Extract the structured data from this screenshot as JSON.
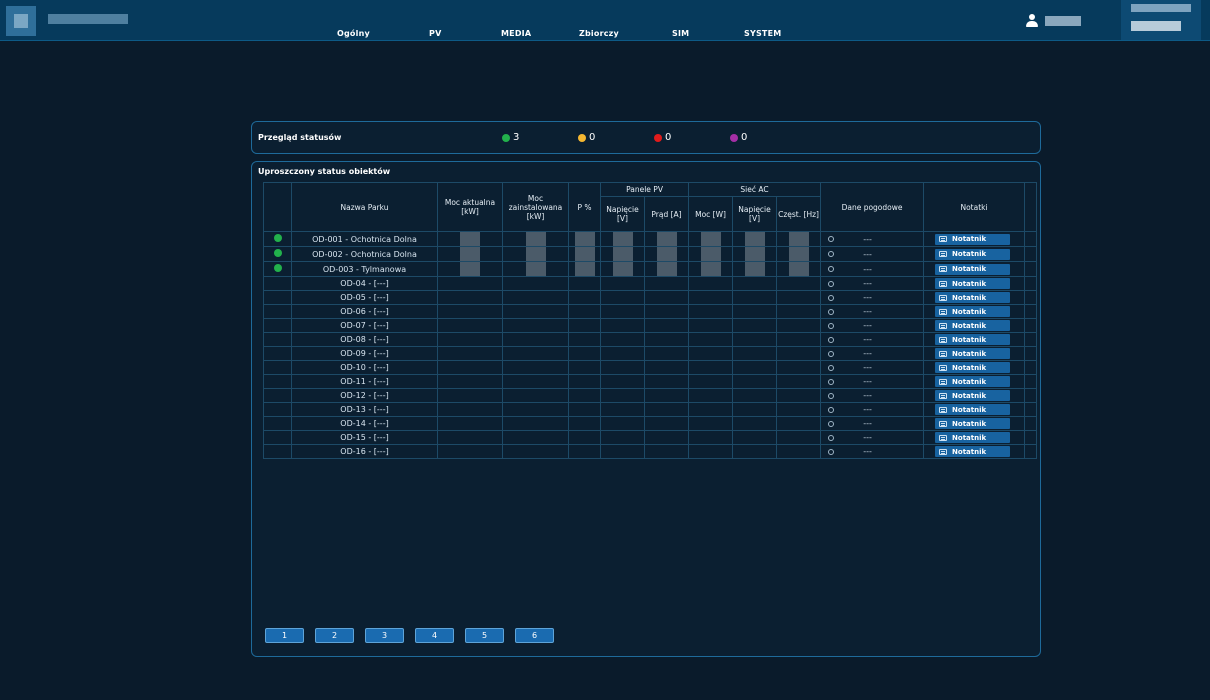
{
  "nav": {
    "items": [
      "Ogólny",
      "PV",
      "MEDIA",
      "Zbiorczy",
      "SIM",
      "SYSTEM"
    ]
  },
  "status_overview": {
    "title": "Przegląd statusów",
    "counts": [
      {
        "color": "#22b14c",
        "value": "3"
      },
      {
        "color": "#f5b731",
        "value": "0"
      },
      {
        "color": "#e01b1b",
        "value": "0"
      },
      {
        "color": "#a52fa6",
        "value": "0"
      }
    ]
  },
  "objects_table": {
    "title": "Uproszczony status obiektów",
    "headers": {
      "name": "Nazwa Parku",
      "current_power": "Moc aktualna [kW]",
      "installed_power": "Moc zainstalowana [kW]",
      "p_percent": "P %",
      "pv_group": "Panele PV",
      "pv_voltage": "Napięcie [V]",
      "pv_current": "Prąd [A]",
      "ac_group": "Sieć AC",
      "ac_power": "Moc [W]",
      "ac_voltage": "Napięcie [V]",
      "ac_freq": "Częst. [Hz]",
      "weather": "Dane pogodowe",
      "notes": "Notatki"
    },
    "weather_placeholder": "---",
    "note_button_label": "Notatnik",
    "rows": [
      {
        "name": "OD-001 - Ochotnica Dolna",
        "status": "green"
      },
      {
        "name": "OD-002 - Ochotnica Dolna",
        "status": "green"
      },
      {
        "name": "OD-003 - Tylmanowa",
        "status": "green"
      },
      {
        "name": "OD-04 - [---]",
        "status": ""
      },
      {
        "name": "OD-05 - [---]",
        "status": ""
      },
      {
        "name": "OD-06 - [---]",
        "status": ""
      },
      {
        "name": "OD-07 - [---]",
        "status": ""
      },
      {
        "name": "OD-08 - [---]",
        "status": ""
      },
      {
        "name": "OD-09 - [---]",
        "status": ""
      },
      {
        "name": "OD-10 - [---]",
        "status": ""
      },
      {
        "name": "OD-11 - [---]",
        "status": ""
      },
      {
        "name": "OD-12 - [---]",
        "status": ""
      },
      {
        "name": "OD-13 - [---]",
        "status": ""
      },
      {
        "name": "OD-14 - [---]",
        "status": ""
      },
      {
        "name": "OD-15 - [---]",
        "status": ""
      },
      {
        "name": "OD-16 - [---]",
        "status": ""
      }
    ]
  },
  "pagination": {
    "pages": [
      "1",
      "2",
      "3",
      "4",
      "5",
      "6"
    ]
  },
  "icons": {
    "user": "user-icon",
    "weather": "sun-icon",
    "note": "note-icon"
  }
}
